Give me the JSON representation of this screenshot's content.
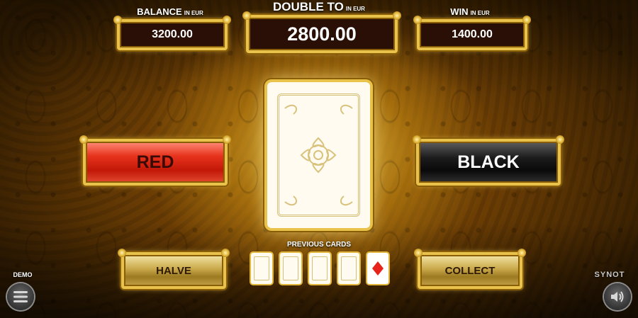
{
  "balance": {
    "label": "BALANCE",
    "unit": "IN EUR",
    "value": "3200.00"
  },
  "double_to": {
    "label": "DOUBLE TO",
    "unit": "IN EUR",
    "value": "2800.00"
  },
  "win": {
    "label": "WIN",
    "unit": "IN EUR",
    "value": "1400.00"
  },
  "buttons": {
    "red": "RED",
    "black": "BLACK",
    "halve": "HALVE",
    "collect": "COLLECT"
  },
  "previous_cards": {
    "label": "PREVIOUS CARDS",
    "last_card_suit": "diamond"
  },
  "demo_label": "DEMO",
  "brand": "SYNOT",
  "icons": {
    "menu": "menu-icon",
    "sound": "speaker-icon"
  },
  "colors": {
    "accent_gold": "#e8c24a",
    "red_button": "#d8281a",
    "black_button": "#1b1b1b",
    "diamond": "#e8231c"
  }
}
